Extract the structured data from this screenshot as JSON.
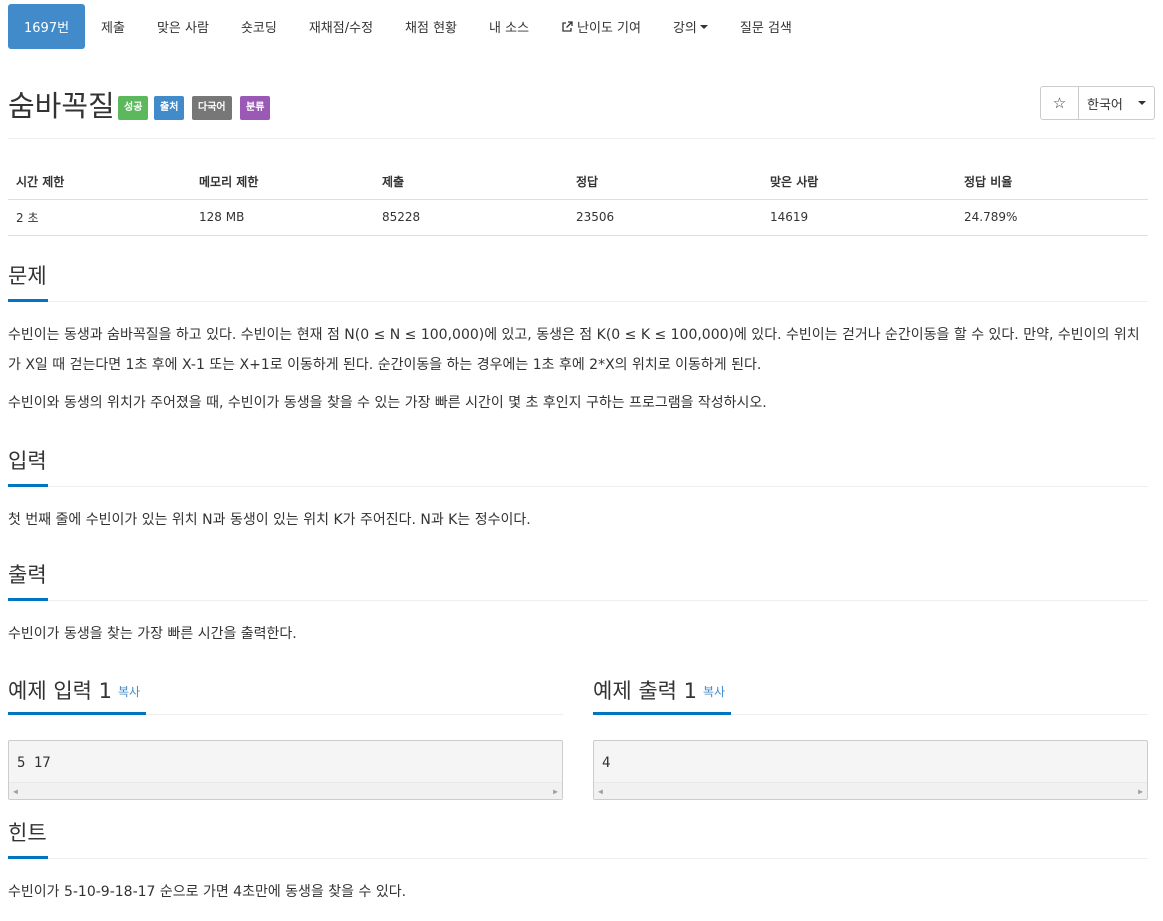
{
  "nav": [
    {
      "label": "1697번",
      "active": true
    },
    {
      "label": "제출"
    },
    {
      "label": "맞은 사람"
    },
    {
      "label": "숏코딩"
    },
    {
      "label": "재채점/수정"
    },
    {
      "label": "채점 현황"
    },
    {
      "label": "내 소스"
    },
    {
      "label": "난이도 기여",
      "icon": "external-link-icon"
    },
    {
      "label": "강의",
      "dropdown": true
    },
    {
      "label": "질문 검색"
    }
  ],
  "problem": {
    "title": "숨바꼭질",
    "labels": [
      {
        "text": "성공",
        "color": "#5cb85c"
      },
      {
        "text": "출처",
        "color": "#428bca"
      },
      {
        "text": "다국어",
        "color": "#777777"
      },
      {
        "text": "분류",
        "color": "#9b59b6"
      }
    ],
    "star_icon": "☆",
    "language": "한국어"
  },
  "stats": {
    "headers": [
      "시간 제한",
      "메모리 제한",
      "제출",
      "정답",
      "맞은 사람",
      "정답 비율"
    ],
    "values": [
      "2 초",
      "128 MB",
      "85228",
      "23506",
      "14619",
      "24.789%"
    ]
  },
  "description": {
    "heading": "문제",
    "p1": "수빈이는 동생과 숨바꼭질을 하고 있다. 수빈이는 현재 점 N(0 ≤ N ≤ 100,000)에 있고, 동생은 점 K(0 ≤ K ≤ 100,000)에 있다. 수빈이는 걷거나 순간이동을 할 수 있다. 만약, 수빈이의 위치가 X일 때 걷는다면 1초 후에 X-1 또는 X+1로 이동하게 된다. 순간이동을 하는 경우에는 1초 후에 2*X의 위치로 이동하게 된다.",
    "p2": "수빈이와 동생의 위치가 주어졌을 때, 수빈이가 동생을 찾을 수 있는 가장 빠른 시간이 몇 초 후인지 구하는 프로그램을 작성하시오."
  },
  "input": {
    "heading": "입력",
    "text": "첫 번째 줄에 수빈이가 있는 위치 N과 동생이 있는 위치 K가 주어진다. N과 K는 정수이다."
  },
  "output": {
    "heading": "출력",
    "text": "수빈이가 동생을 찾는 가장 빠른 시간을 출력한다."
  },
  "samples": {
    "input_heading": "예제 입력 1",
    "output_heading": "예제 출력 1",
    "copy_label": "복사",
    "input_value": "5 17",
    "output_value": "4"
  },
  "hint": {
    "heading": "힌트",
    "text": "수빈이가 5-10-9-18-17 순으로 가면 4초만에 동생을 찾을 수 있다."
  },
  "colors": {
    "accent": "#428bca",
    "underline": "#0076c0"
  }
}
